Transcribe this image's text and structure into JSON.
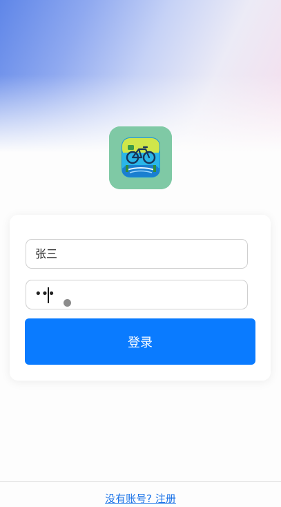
{
  "logo": {
    "icon": "bicycle-app-logo-icon"
  },
  "login_form": {
    "username_value": "张三",
    "password_masked": "•••",
    "login_label": "登录"
  },
  "footer": {
    "register_link": "没有账号? 注册"
  },
  "colors": {
    "primary": "#0a7bff",
    "link": "#1a73e8"
  }
}
